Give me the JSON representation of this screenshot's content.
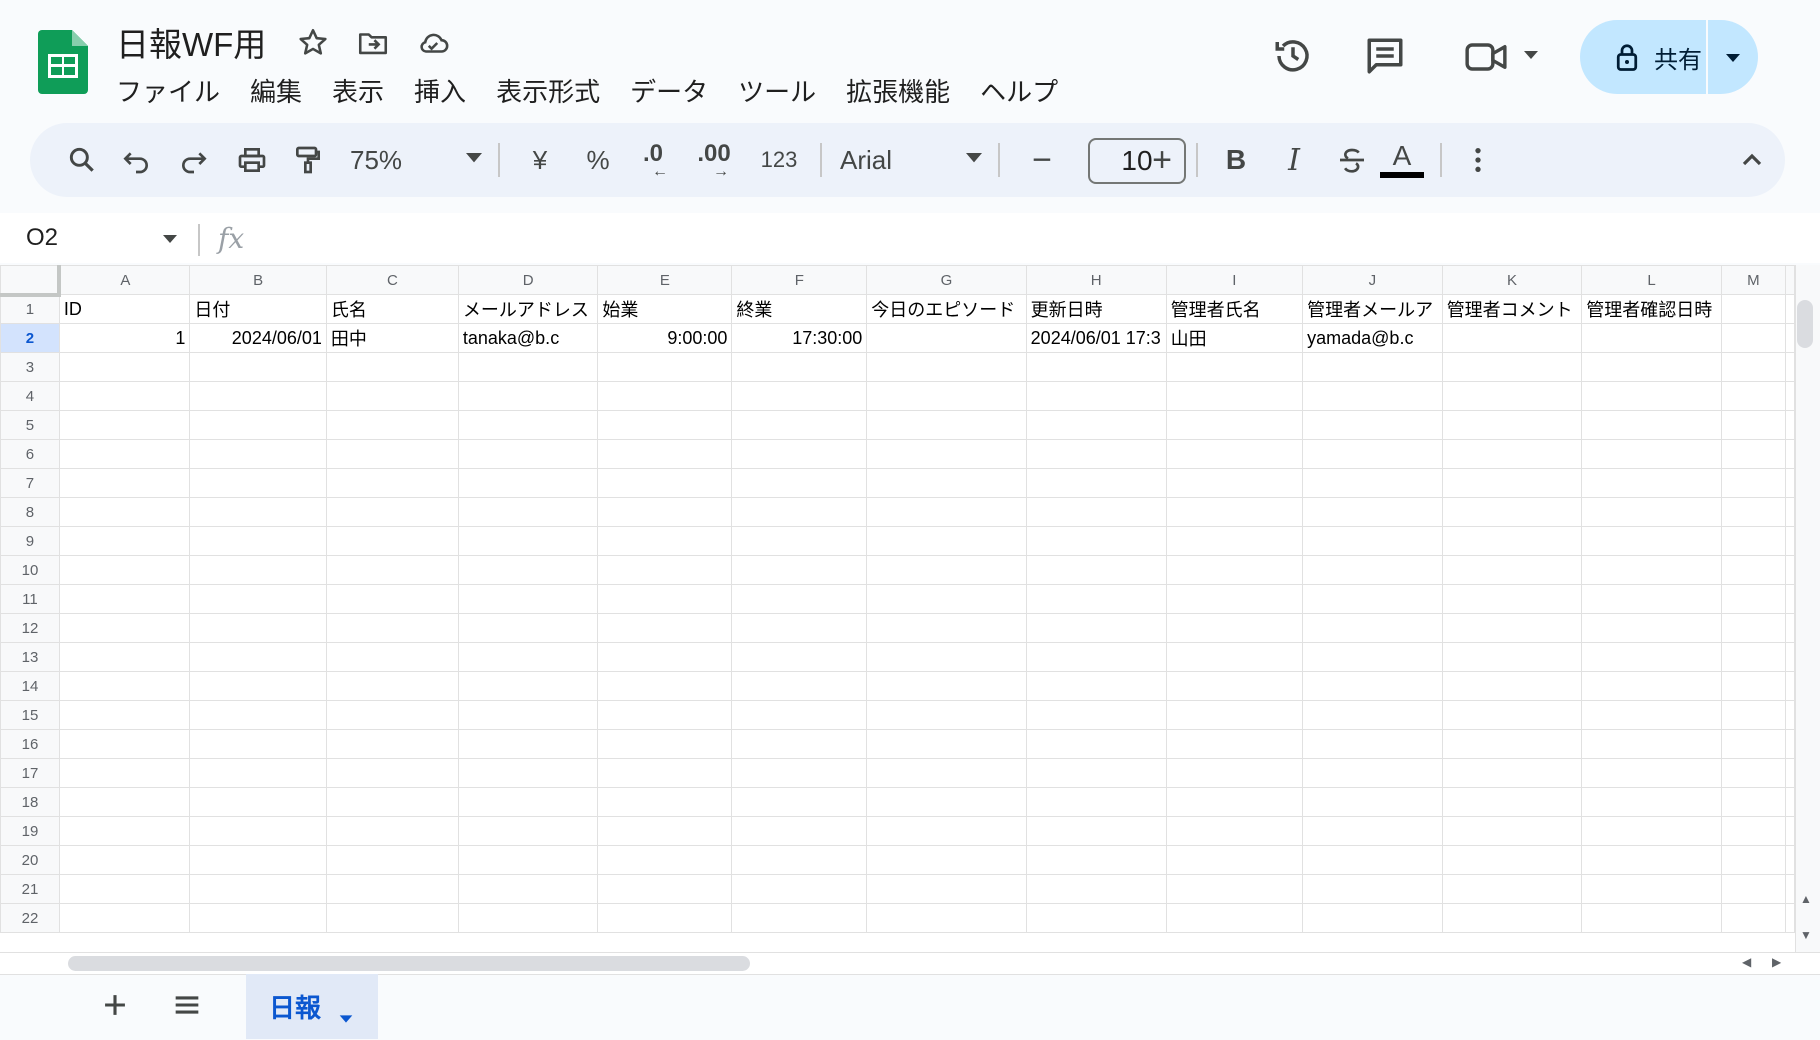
{
  "app": {
    "doc_title": "日報WF用",
    "accent": "#0f9d58"
  },
  "menu": [
    "ファイル",
    "編集",
    "表示",
    "挿入",
    "表示形式",
    "データ",
    "ツール",
    "拡張機能",
    "ヘルプ"
  ],
  "share": {
    "label": "共有",
    "bg": "#c2e7ff"
  },
  "toolbar": {
    "zoom": "75%",
    "currency": "¥",
    "percent": "%",
    "dec_decrease": ".0",
    "dec_increase": ".00",
    "number_format": "123",
    "font": "Arial",
    "font_size": "10",
    "bold": "B",
    "italic": "I",
    "text_color_glyph": "A"
  },
  "formula_bar": {
    "name_box": "O2",
    "fx": "fx",
    "content": ""
  },
  "sheet": {
    "columns": [
      "A",
      "B",
      "C",
      "D",
      "E",
      "F",
      "G",
      "H",
      "I",
      "J",
      "K",
      "L",
      "M"
    ],
    "rows": [
      [
        "ID",
        "日付",
        "氏名",
        "メールアドレス",
        "始業",
        "終業",
        "今日のエピソード",
        "更新日時",
        "管理者氏名",
        "管理者メールア",
        "管理者コメント",
        "管理者確認日時",
        ""
      ],
      [
        "1",
        "2024/06/01",
        "田中",
        "tanaka@b.c",
        "9:00:00",
        "17:30:00",
        "",
        "2024/06/01 17:3",
        "山田",
        "yamada@b.c",
        "",
        "",
        ""
      ]
    ],
    "row_count": 22,
    "selected_row": 2
  },
  "tabs": [
    {
      "label": "日報",
      "active": true
    }
  ]
}
